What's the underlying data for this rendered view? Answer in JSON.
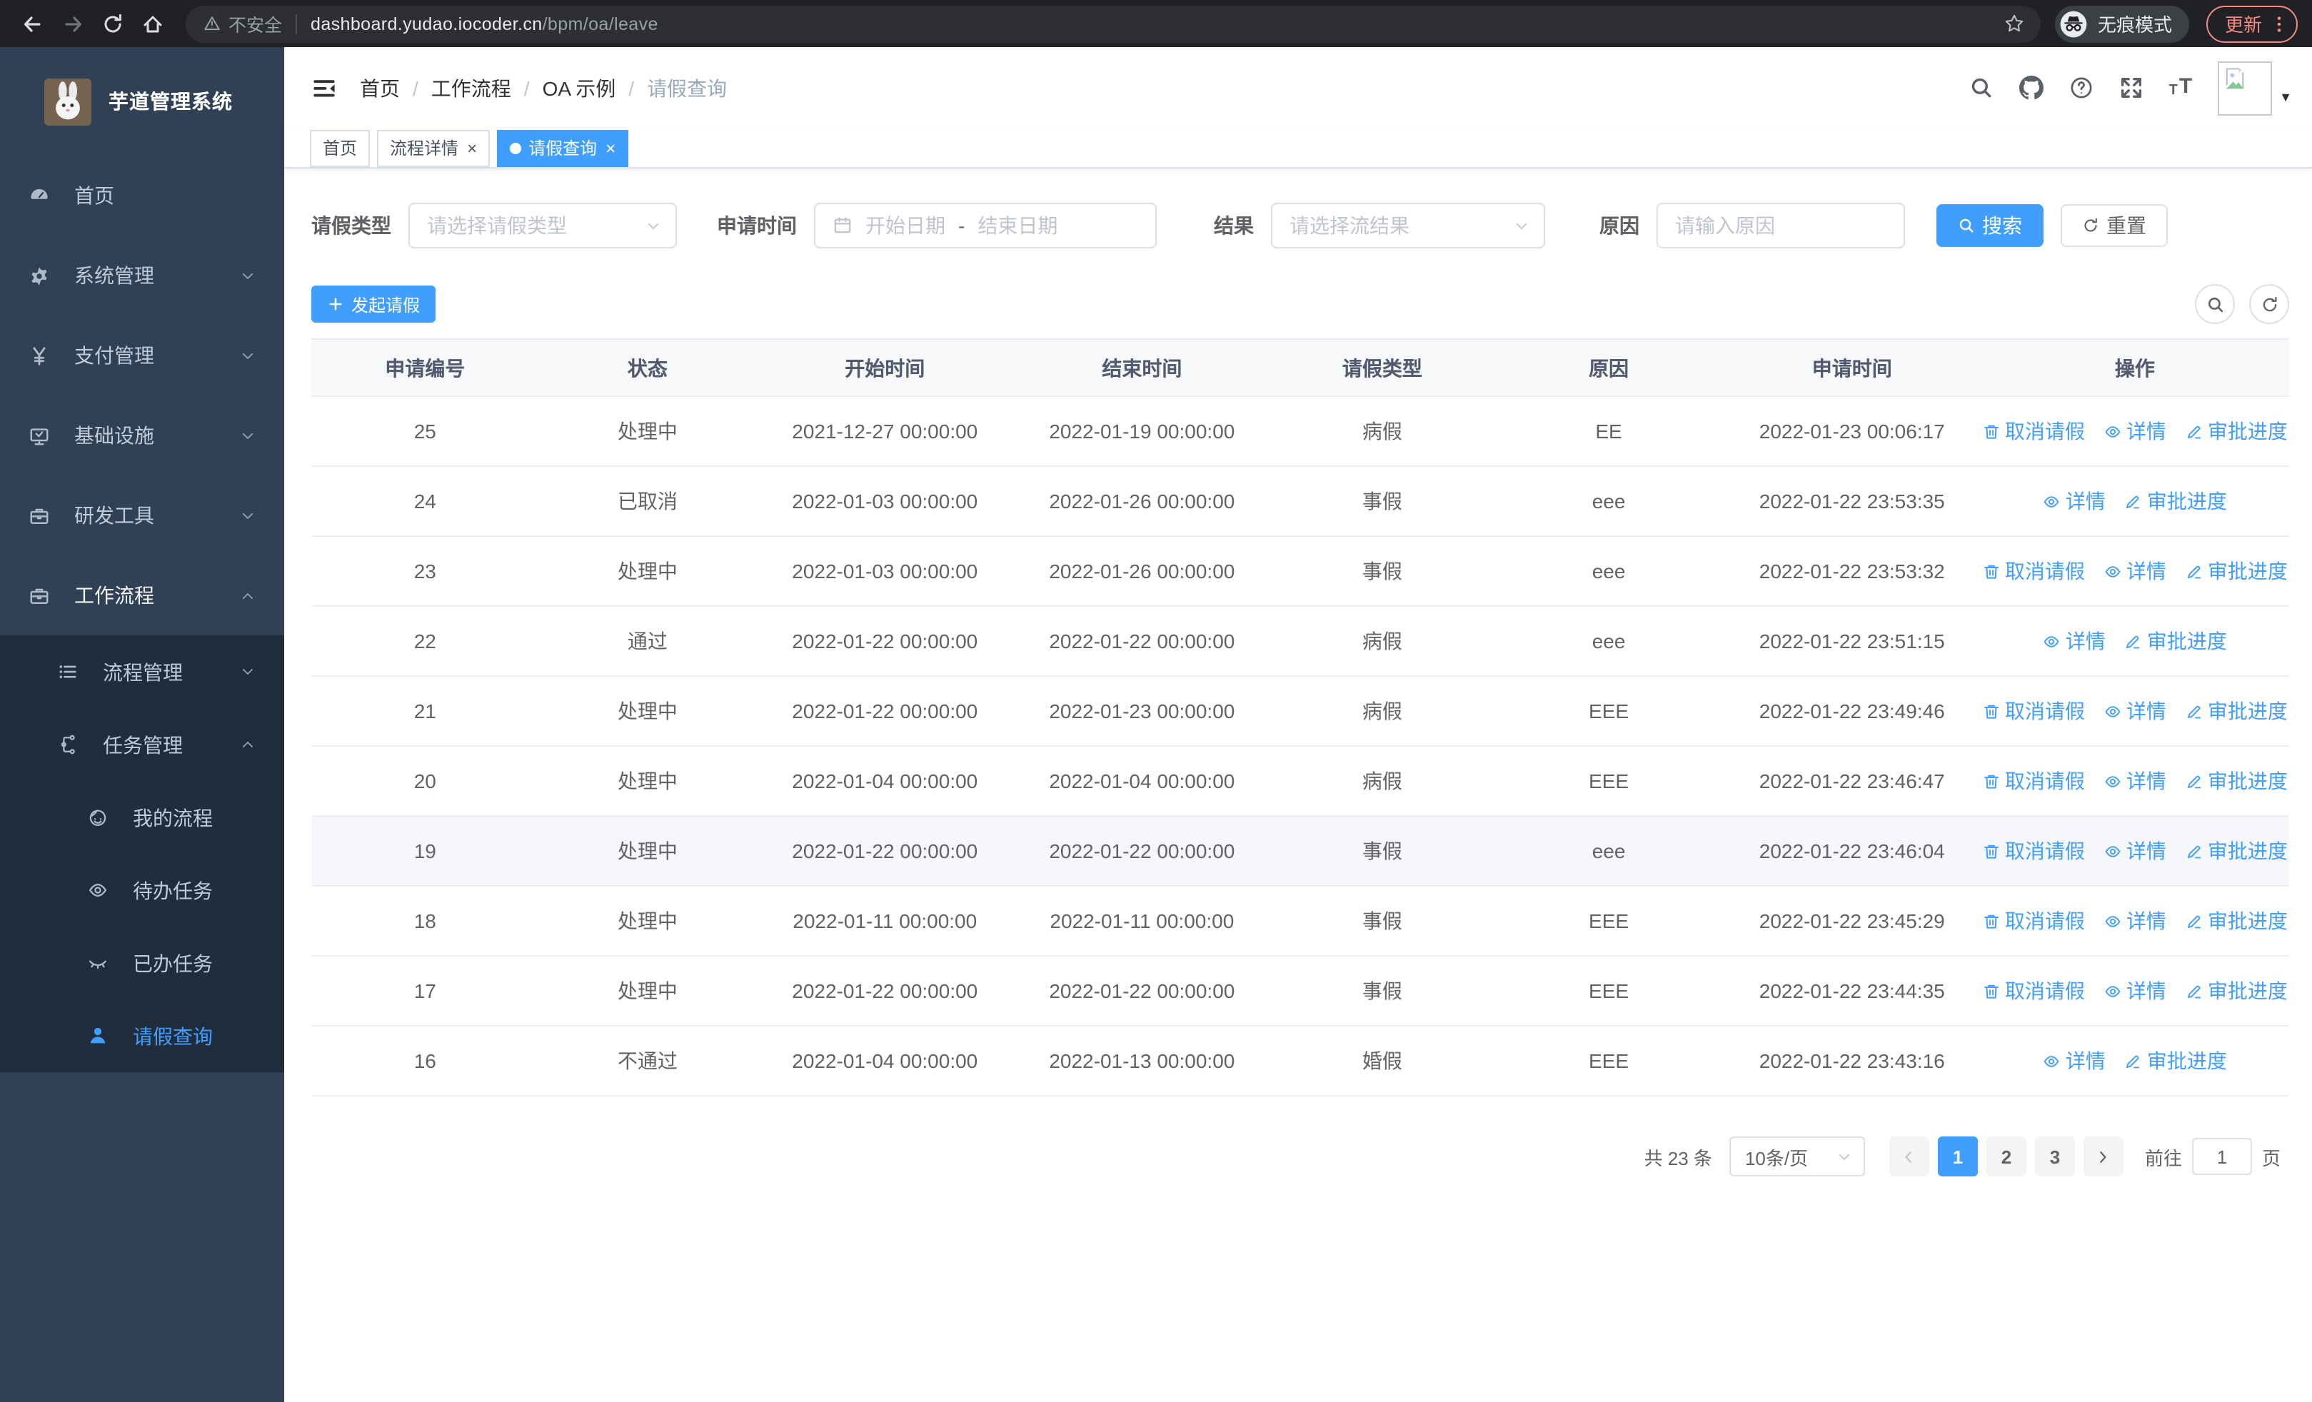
{
  "browser": {
    "security_label": "不安全",
    "url_host": "dashboard.yudao.iocoder.cn",
    "url_path": "/bpm/oa/leave",
    "incognito_label": "无痕模式",
    "update_label": "更新"
  },
  "sidebar": {
    "title": "芋道管理系统",
    "menu": [
      {
        "key": "home",
        "label": "首页",
        "icon": "dashboard"
      },
      {
        "key": "system",
        "label": "系统管理",
        "icon": "gear",
        "expandable": true,
        "expanded": false
      },
      {
        "key": "payment",
        "label": "支付管理",
        "icon": "yen",
        "expandable": true,
        "expanded": false
      },
      {
        "key": "infrastructure",
        "label": "基础设施",
        "icon": "monitor",
        "expandable": true,
        "expanded": false
      },
      {
        "key": "dev-tools",
        "label": "研发工具",
        "icon": "toolbox",
        "expandable": true,
        "expanded": false
      },
      {
        "key": "workflow",
        "label": "工作流程",
        "icon": "briefcase",
        "expandable": true,
        "expanded": true,
        "children": [
          {
            "key": "process-mgmt",
            "label": "流程管理",
            "icon": "list",
            "expandable": true,
            "expanded": false
          },
          {
            "key": "task-mgmt",
            "label": "任务管理",
            "icon": "tree",
            "expandable": true,
            "expanded": true,
            "children": [
              {
                "key": "my-process",
                "label": "我的流程",
                "icon": "face"
              },
              {
                "key": "todo-tasks",
                "label": "待办任务",
                "icon": "eye"
              },
              {
                "key": "done-tasks",
                "label": "已办任务",
                "icon": "eye-closed"
              },
              {
                "key": "leave-query",
                "label": "请假查询",
                "icon": "person",
                "active": true
              }
            ]
          }
        ]
      }
    ]
  },
  "header": {
    "breadcrumb": [
      "首页",
      "工作流程",
      "OA 示例",
      "请假查询"
    ]
  },
  "tabs": [
    {
      "key": "home",
      "label": "首页",
      "closable": false,
      "active": false
    },
    {
      "key": "process-detail",
      "label": "流程详情",
      "closable": true,
      "active": false
    },
    {
      "key": "leave-query",
      "label": "请假查询",
      "closable": true,
      "active": true
    }
  ],
  "filters": {
    "leave_type_label": "请假类型",
    "leave_type_placeholder": "请选择请假类型",
    "apply_time_label": "申请时间",
    "date_start_placeholder": "开始日期",
    "date_separator": "-",
    "date_end_placeholder": "结束日期",
    "result_label": "结果",
    "result_placeholder": "请选择流结果",
    "reason_label": "原因",
    "reason_placeholder": "请输入原因",
    "search_label": "搜索",
    "reset_label": "重置"
  },
  "toolbar": {
    "create_label": "发起请假"
  },
  "table": {
    "columns": [
      "申请编号",
      "状态",
      "开始时间",
      "结束时间",
      "请假类型",
      "原因",
      "申请时间",
      "操作"
    ],
    "action_labels": {
      "cancel": "取消请假",
      "detail": "详情",
      "progress": "审批进度"
    },
    "rows": [
      {
        "id": "25",
        "status": "处理中",
        "start": "2021-12-27 00:00:00",
        "end": "2022-01-19 00:00:00",
        "type": "病假",
        "reason": "EE",
        "applied": "2022-01-23 00:06:17",
        "actions": [
          "cancel",
          "detail",
          "progress"
        ],
        "highlight": false
      },
      {
        "id": "24",
        "status": "已取消",
        "start": "2022-01-03 00:00:00",
        "end": "2022-01-26 00:00:00",
        "type": "事假",
        "reason": "eee",
        "applied": "2022-01-22 23:53:35",
        "actions": [
          "detail",
          "progress"
        ],
        "highlight": false
      },
      {
        "id": "23",
        "status": "处理中",
        "start": "2022-01-03 00:00:00",
        "end": "2022-01-26 00:00:00",
        "type": "事假",
        "reason": "eee",
        "applied": "2022-01-22 23:53:32",
        "actions": [
          "cancel",
          "detail",
          "progress"
        ],
        "highlight": false
      },
      {
        "id": "22",
        "status": "通过",
        "start": "2022-01-22 00:00:00",
        "end": "2022-01-22 00:00:00",
        "type": "病假",
        "reason": "eee",
        "applied": "2022-01-22 23:51:15",
        "actions": [
          "detail",
          "progress"
        ],
        "highlight": false
      },
      {
        "id": "21",
        "status": "处理中",
        "start": "2022-01-22 00:00:00",
        "end": "2022-01-23 00:00:00",
        "type": "病假",
        "reason": "EEE",
        "applied": "2022-01-22 23:49:46",
        "actions": [
          "cancel",
          "detail",
          "progress"
        ],
        "highlight": false
      },
      {
        "id": "20",
        "status": "处理中",
        "start": "2022-01-04 00:00:00",
        "end": "2022-01-04 00:00:00",
        "type": "病假",
        "reason": "EEE",
        "applied": "2022-01-22 23:46:47",
        "actions": [
          "cancel",
          "detail",
          "progress"
        ],
        "highlight": false
      },
      {
        "id": "19",
        "status": "处理中",
        "start": "2022-01-22 00:00:00",
        "end": "2022-01-22 00:00:00",
        "type": "事假",
        "reason": "eee",
        "applied": "2022-01-22 23:46:04",
        "actions": [
          "cancel",
          "detail",
          "progress"
        ],
        "highlight": true
      },
      {
        "id": "18",
        "status": "处理中",
        "start": "2022-01-11 00:00:00",
        "end": "2022-01-11 00:00:00",
        "type": "事假",
        "reason": "EEE",
        "applied": "2022-01-22 23:45:29",
        "actions": [
          "cancel",
          "detail",
          "progress"
        ],
        "highlight": false
      },
      {
        "id": "17",
        "status": "处理中",
        "start": "2022-01-22 00:00:00",
        "end": "2022-01-22 00:00:00",
        "type": "事假",
        "reason": "EEE",
        "applied": "2022-01-22 23:44:35",
        "actions": [
          "cancel",
          "detail",
          "progress"
        ],
        "highlight": false
      },
      {
        "id": "16",
        "status": "不通过",
        "start": "2022-01-04 00:00:00",
        "end": "2022-01-13 00:00:00",
        "type": "婚假",
        "reason": "EEE",
        "applied": "2022-01-22 23:43:16",
        "actions": [
          "detail",
          "progress"
        ],
        "highlight": false
      }
    ]
  },
  "pagination": {
    "total_label": "共 23 条",
    "page_size": "10条/页",
    "pages": [
      "1",
      "2",
      "3"
    ],
    "active_page": "1",
    "goto_label": "前往",
    "goto_value": "1",
    "page_unit": "页"
  },
  "colors": {
    "primary": "#409EFF",
    "sidebar_bg": "#304156",
    "submenu_bg": "#1f2d3d",
    "update_pill": "#f28b82",
    "table_border": "#ebeef5"
  }
}
